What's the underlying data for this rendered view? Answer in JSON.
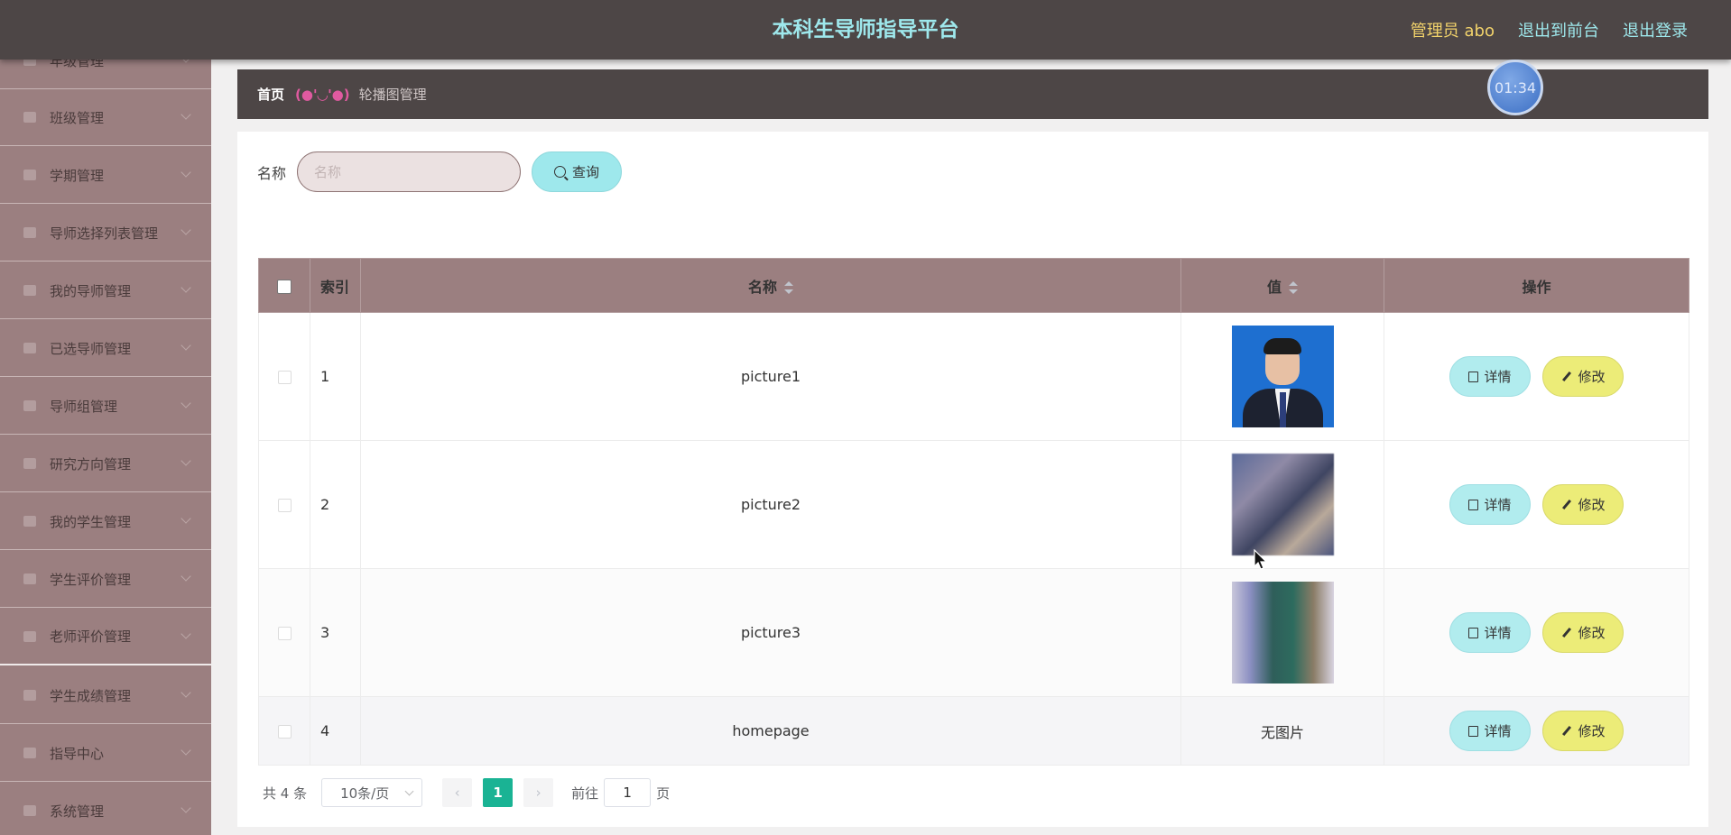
{
  "header": {
    "title": "本科生导师指导平台",
    "admin": "管理员 abo",
    "to_front": "退出到前台",
    "logout": "退出登录"
  },
  "timer": "01:34",
  "sidebar": {
    "items": [
      {
        "label": "年级管理",
        "icon": "grade-icon"
      },
      {
        "label": "班级管理",
        "icon": "flag-icon"
      },
      {
        "label": "学期管理",
        "icon": "calendar-icon"
      },
      {
        "label": "导师选择列表管理",
        "icon": "list-icon"
      },
      {
        "label": "我的导师管理",
        "icon": "user-icon"
      },
      {
        "label": "已选导师管理",
        "icon": "doc-icon"
      },
      {
        "label": "导师组管理",
        "icon": "group-icon"
      },
      {
        "label": "研究方向管理",
        "icon": "compass-icon"
      },
      {
        "label": "我的学生管理",
        "icon": "student-icon"
      },
      {
        "label": "学生评价管理",
        "icon": "send-icon"
      },
      {
        "label": "老师评价管理",
        "icon": "clock-icon"
      },
      {
        "label": "学生成绩管理",
        "icon": "menu-icon"
      },
      {
        "label": "指导中心",
        "icon": "note-icon"
      },
      {
        "label": "系统管理",
        "icon": "setting-icon"
      }
    ]
  },
  "breadcrumb": {
    "home": "首页",
    "face": "(●'◡'●)",
    "current": "轮播图管理"
  },
  "search": {
    "label": "名称",
    "placeholder": "名称",
    "button": "查询"
  },
  "table": {
    "headers": {
      "index": "索引",
      "name": "名称",
      "value": "值",
      "action": "操作"
    },
    "rows": [
      {
        "index": "1",
        "name": "picture1",
        "value": "",
        "detail": "详情",
        "edit": "修改"
      },
      {
        "index": "2",
        "name": "picture2",
        "value": "",
        "detail": "详情",
        "edit": "修改"
      },
      {
        "index": "3",
        "name": "picture3",
        "value": "",
        "detail": "详情",
        "edit": "修改"
      },
      {
        "index": "4",
        "name": "homepage",
        "value": "无图片",
        "detail": "详情",
        "edit": "修改"
      }
    ]
  },
  "pagination": {
    "total": "共 4 条",
    "page_size": "10条/页",
    "current_page": "1",
    "goto_prefix": "前往",
    "goto_value": "1",
    "goto_suffix": "页",
    "prev": "‹",
    "next": "›"
  }
}
